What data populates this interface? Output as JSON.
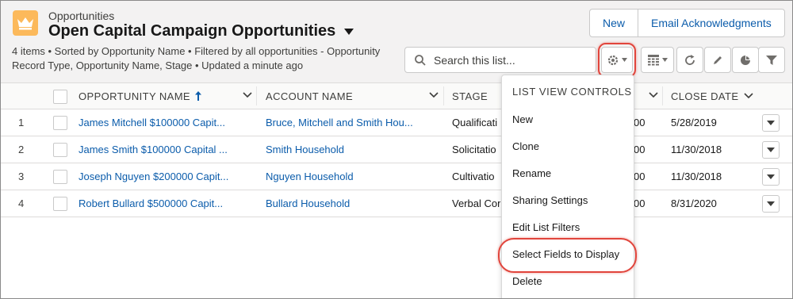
{
  "header": {
    "object_label": "Opportunities",
    "view_title": "Open Capital Campaign Opportunities",
    "summary": "4 items • Sorted by Opportunity Name • Filtered by all opportunities - Opportunity Record Type, Opportunity Name, Stage • Updated a minute ago",
    "buttons": [
      "New",
      "Email Acknowledgments"
    ],
    "search_placeholder": "Search this list..."
  },
  "table": {
    "columns": [
      "OPPORTUNITY NAME",
      "ACCOUNT NAME",
      "STAGE",
      "CLOSE DATE"
    ],
    "sorted_column": "OPPORTUNITY NAME",
    "rows": [
      {
        "num": "1",
        "opportunity": "James Mitchell $100000 Capit...",
        "account": "Bruce, Mitchell and Smith Hou...",
        "stage": "Qualificati",
        "amount_tail": "00",
        "close_date": "5/28/2019"
      },
      {
        "num": "2",
        "opportunity": "James Smith $100000 Capital ...",
        "account": "Smith Household",
        "stage": "Solicitatio",
        "amount_tail": "00",
        "close_date": "11/30/2018"
      },
      {
        "num": "3",
        "opportunity": "Joseph Nguyen $200000 Capit...",
        "account": "Nguyen Household",
        "stage": "Cultivatio",
        "amount_tail": "00",
        "close_date": "11/30/2018"
      },
      {
        "num": "4",
        "opportunity": "Robert Bullard $500000 Capit...",
        "account": "Bullard Household",
        "stage": "Verbal Cor",
        "amount_tail": "00",
        "close_date": "8/31/2020"
      }
    ]
  },
  "menu": {
    "header": "LIST VIEW CONTROLS",
    "items": [
      "New",
      "Clone",
      "Rename",
      "Sharing Settings",
      "Edit List Filters",
      "Select Fields to Display",
      "Delete"
    ]
  },
  "colors": {
    "accent": "#0b5cab",
    "highlight": "#e1453c",
    "app_icon": "#fcb95b"
  }
}
